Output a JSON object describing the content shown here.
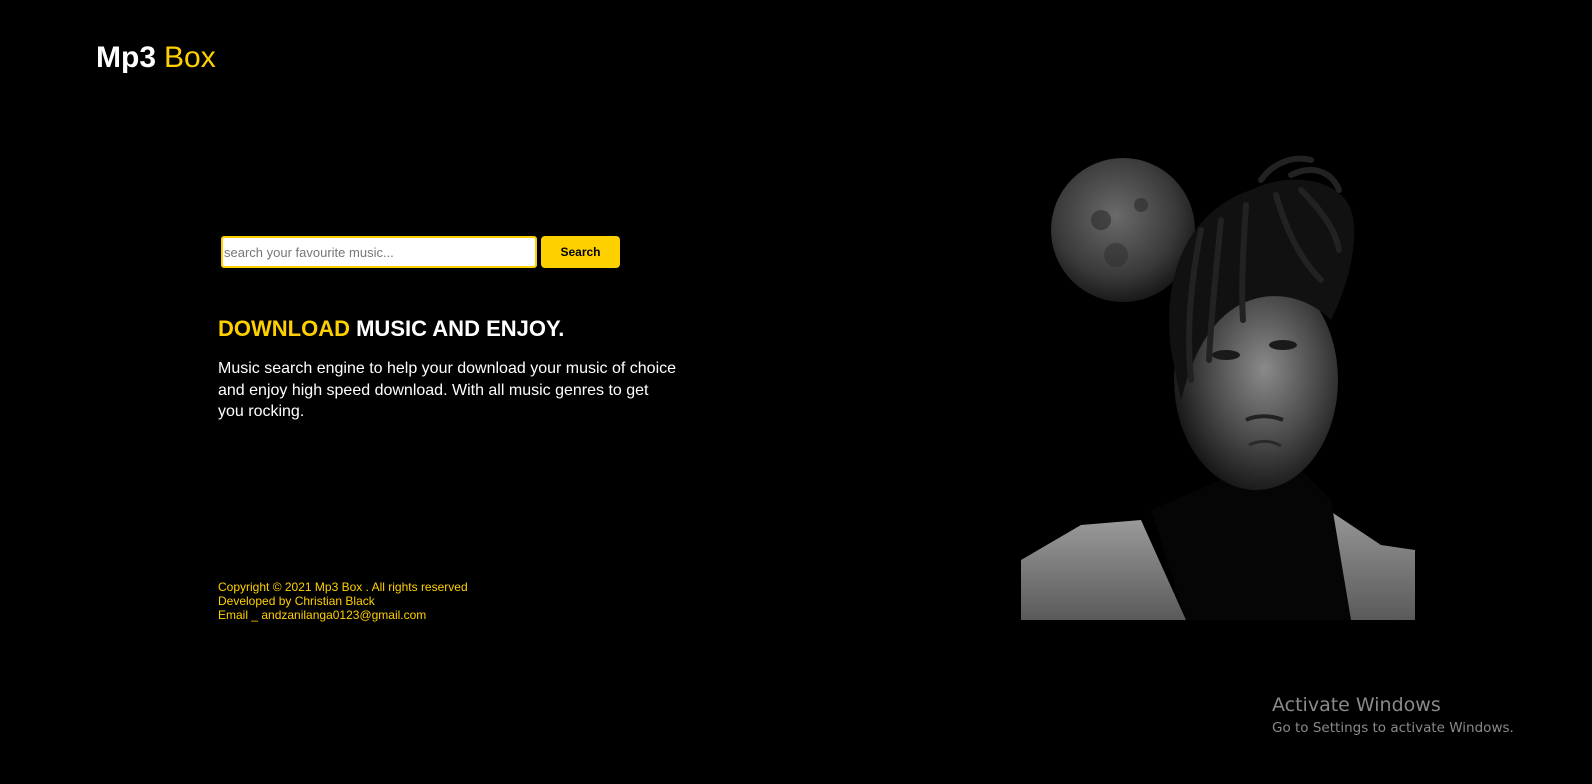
{
  "brand": {
    "part1": "Mp3",
    "part2": "Box"
  },
  "search": {
    "placeholder": "search your favourite music...",
    "button_label": "Search"
  },
  "hero": {
    "headline_accent": "DOWNLOAD",
    "headline_rest": "MUSIC AND ENJOY.",
    "description": "Music search engine to help your download your music of choice and enjoy high speed download. With all music genres to get you rocking."
  },
  "footer": {
    "copyright": "Copyright © 2021 Mp3 Box . All rights reserved",
    "developer": "Developed by Christian Black",
    "email": "Email _ andzanilanga0123@gmail.com"
  },
  "image": {
    "icon": "artist-portrait-image"
  },
  "windows_watermark": {
    "title": "Activate Windows",
    "subtitle": "Go to Settings to activate Windows."
  },
  "colors": {
    "background": "#000000",
    "accent": "#ffd000",
    "text": "#ffffff"
  }
}
